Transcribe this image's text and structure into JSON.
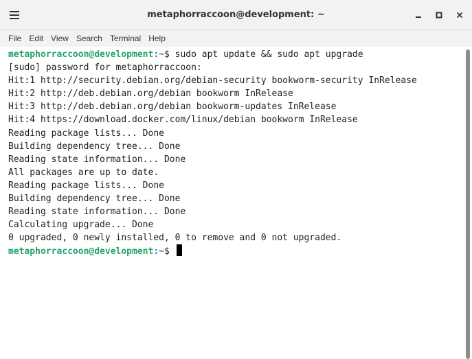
{
  "window": {
    "title": "metaphorraccoon@development: ~",
    "controls": {
      "minimize": "_",
      "maximize": "□",
      "close": "×"
    }
  },
  "menubar": {
    "items": [
      "File",
      "Edit",
      "View",
      "Search",
      "Terminal",
      "Help"
    ]
  },
  "terminal": {
    "prompt_user_host": "metaphorraccoon@development",
    "prompt_path": ":~",
    "prompt_symbol": "$ ",
    "command": "sudo apt update && sudo apt upgrade",
    "output": [
      "[sudo] password for metaphorraccoon:",
      "Hit:1 http://security.debian.org/debian-security bookworm-security InRelease",
      "Hit:2 http://deb.debian.org/debian bookworm InRelease",
      "Hit:3 http://deb.debian.org/debian bookworm-updates InRelease",
      "Hit:4 https://download.docker.com/linux/debian bookworm InRelease",
      "Reading package lists... Done",
      "Building dependency tree... Done",
      "Reading state information... Done",
      "All packages are up to date.",
      "Reading package lists... Done",
      "Building dependency tree... Done",
      "Reading state information... Done",
      "Calculating upgrade... Done",
      "0 upgraded, 0 newly installed, 0 to remove and 0 not upgraded."
    ]
  },
  "colors": {
    "prompt_user": "#26a269",
    "prompt_path": "#3a6fc4",
    "text": "#1e1e1e",
    "titlebar": "#f2f2f2"
  },
  "icons": {
    "menu": "hamburger-icon",
    "minimize": "minimize-icon",
    "maximize": "maximize-icon",
    "close": "close-icon"
  }
}
